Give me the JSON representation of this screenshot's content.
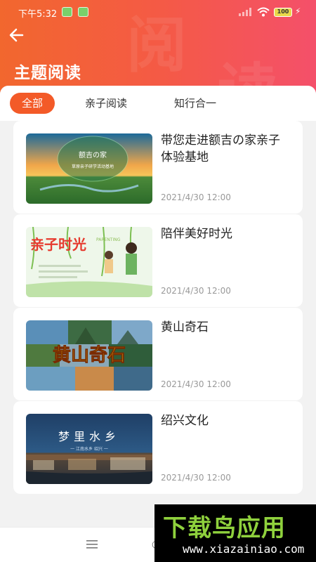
{
  "status_bar": {
    "time": "下午5:32",
    "battery": "100"
  },
  "header": {
    "title": "主题阅读",
    "watermark": [
      "阅",
      "读"
    ]
  },
  "tabs": [
    {
      "label": "全部",
      "active": true
    },
    {
      "label": "亲子阅读",
      "active": false
    },
    {
      "label": "知行合一",
      "active": false
    }
  ],
  "articles": [
    {
      "title": "带您走进额吉の家亲子体验基地",
      "date": "2021/4/30 12:00",
      "thumb_text": "额吉の家",
      "thumb_subtext": "草原亲子研学活动基地"
    },
    {
      "title": "陪伴美好时光",
      "date": "2021/4/30 12:00",
      "thumb_text": "亲子时光",
      "thumb_subtext": "PARENTING"
    },
    {
      "title": "黄山奇石",
      "date": "2021/4/30 12:00",
      "thumb_text": "黄山奇石"
    },
    {
      "title": "绍兴文化",
      "date": "2021/4/30 12:00",
      "thumb_text": "梦里水乡",
      "thumb_subtext": "一 江南水乡 绍兴 一"
    }
  ],
  "brand": {
    "name": "下载鸟应用",
    "url": "www.xiazainiao.com"
  },
  "colors": {
    "accent": "#f35a28",
    "header_start": "#f2672e",
    "header_end": "#f4506a",
    "brand_green": "#8fd13d"
  }
}
